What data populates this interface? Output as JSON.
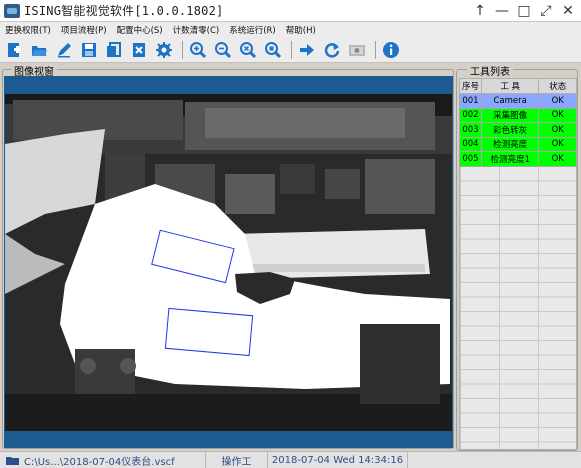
{
  "window": {
    "title": "ISING智能视觉软件[1.0.0.1802]",
    "controls": [
      "↑",
      "—",
      "□",
      "⤢",
      "✕"
    ]
  },
  "menu": [
    "更换权限(T)",
    "项目流程(P)",
    "配置中心(S)",
    "计数清零(C)",
    "系统运行(R)",
    "帮助(H)"
  ],
  "toolbar": {
    "icons": [
      "new-icon",
      "open-icon",
      "edit-icon",
      "save-icon",
      "copy-icon",
      "delete-icon",
      "settings-icon",
      "zoom-in-icon",
      "zoom-out-icon",
      "zoom-fit-icon",
      "zoom-actual-icon",
      "run-icon",
      "refresh-icon",
      "camera-icon",
      "info-icon"
    ]
  },
  "image_view": {
    "label": "图像视窗"
  },
  "tools": {
    "label": "工具列表",
    "headers": [
      "序号",
      "工 具",
      "状态"
    ],
    "rows": [
      {
        "id": "001",
        "name": "Camera",
        "status": "OK",
        "color": "#8aa6ff"
      },
      {
        "id": "002",
        "name": "采集图像",
        "status": "OK",
        "color": "#00ff00"
      },
      {
        "id": "003",
        "name": "彩色转灰",
        "status": "OK",
        "color": "#00ff00"
      },
      {
        "id": "004",
        "name": "检测亮度",
        "status": "OK",
        "color": "#00ff00"
      },
      {
        "id": "005",
        "name": "检测亮度1",
        "status": "OK",
        "color": "#00ff00"
      }
    ]
  },
  "status": {
    "path": "C:\\Us...\\2018-07-04仪表台.vscf",
    "user": "操作工",
    "datetime": "2018-07-04 Wed 14:34:16"
  },
  "colors": {
    "accent": "#1c5a8f",
    "ok": "#00ff00"
  }
}
